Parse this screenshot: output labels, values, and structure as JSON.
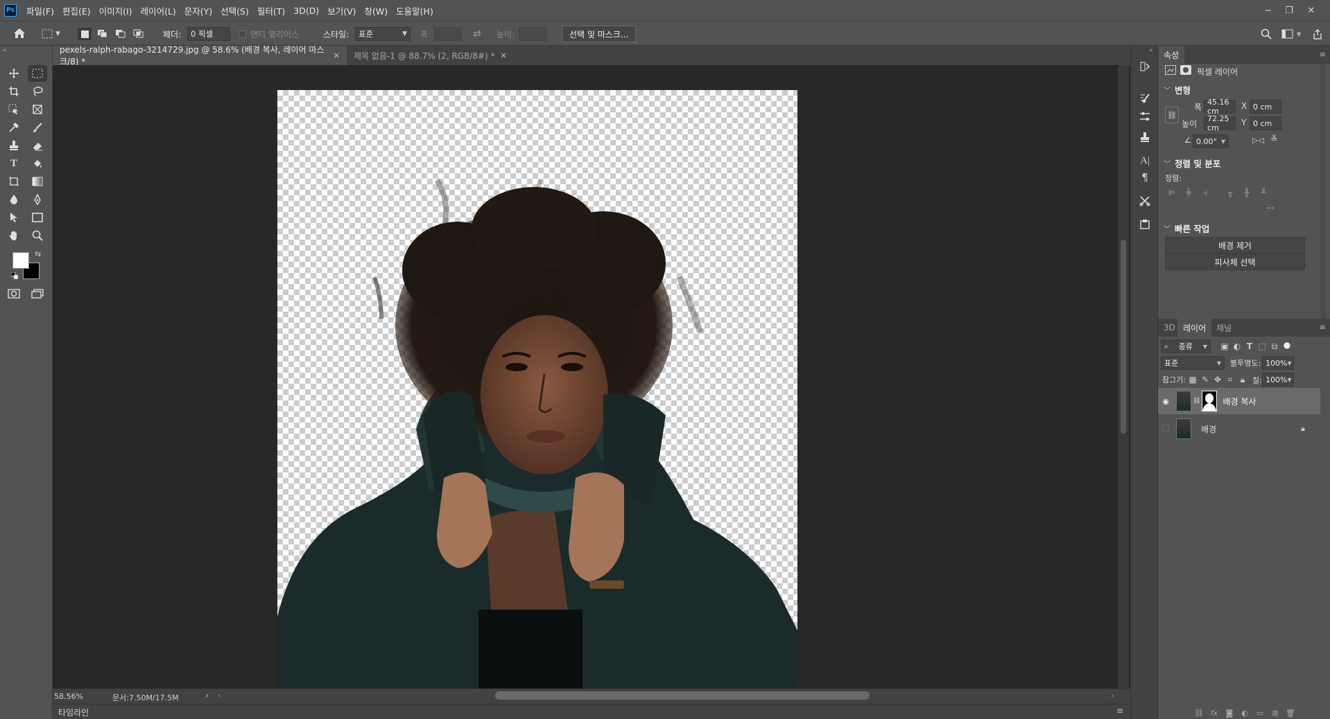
{
  "app": {
    "logo": "Ps"
  },
  "menu": [
    "파일(F)",
    "편집(E)",
    "이미지(I)",
    "레이어(L)",
    "문자(Y)",
    "선택(S)",
    "필터(T)",
    "3D(D)",
    "보기(V)",
    "창(W)",
    "도움말(H)"
  ],
  "window_controls": {
    "minimize": "−",
    "restore": "❐",
    "close": "✕"
  },
  "options": {
    "feather_label": "페더:",
    "feather_value": "0 픽셀",
    "antialias_label": "앤티 앨리어스",
    "style_label": "스타일:",
    "style_value": "표준",
    "width_label": "폭:",
    "height_label": "높이:",
    "select_mask_button": "선택 및 마스크..."
  },
  "tabs": [
    {
      "label": "pexels-ralph-rabago-3214729.jpg @ 58.6% (배경 복사, 레이어 마스크/8) *",
      "active": true
    },
    {
      "label": "제목 없음-1 @ 88.7% (2, RGB/8#) *",
      "active": false
    }
  ],
  "status": {
    "zoom": "58.56%",
    "doc_info": "문서:7.50M/17.5M"
  },
  "timeline_label": "타임라인",
  "properties": {
    "tab": "속성",
    "layer_type": "픽셀 레이어",
    "transform_title": "변형",
    "w_label": "폭",
    "w_value": "45.16 cm",
    "h_label": "높이",
    "h_value": "72.25 cm",
    "x_label": "X",
    "x_value": "0 cm",
    "y_label": "Y",
    "y_value": "0 cm",
    "angle_value": "0.00°",
    "align_title": "정렬 및 분포",
    "align_label": "정렬:",
    "more": "...",
    "quick_title": "빠른 작업",
    "remove_bg_button": "배경 제거",
    "select_subject_button": "피사체 선택"
  },
  "layers_panel": {
    "tabs": [
      "3D",
      "레이어",
      "채널"
    ],
    "active_tab": "레이어",
    "filter_value": "종류",
    "blend_mode": "표준",
    "opacity_label": "불투명도:",
    "opacity_value": "100%",
    "lock_label": "잠그기:",
    "fill_label": "칠:",
    "fill_value": "100%",
    "layers": [
      {
        "name": "배경 복사",
        "visible": true,
        "selected": true,
        "has_mask": true,
        "locked": false
      },
      {
        "name": "배경",
        "visible": false,
        "selected": false,
        "has_mask": false,
        "locked": true
      }
    ]
  },
  "colors": {
    "panel_bg": "#535353",
    "workspace_bg": "#282828",
    "tab_bar_bg": "#424242",
    "selected_layer": "#6a6a6a",
    "foreground_color": "#ffffff",
    "background_color": "#000000"
  }
}
